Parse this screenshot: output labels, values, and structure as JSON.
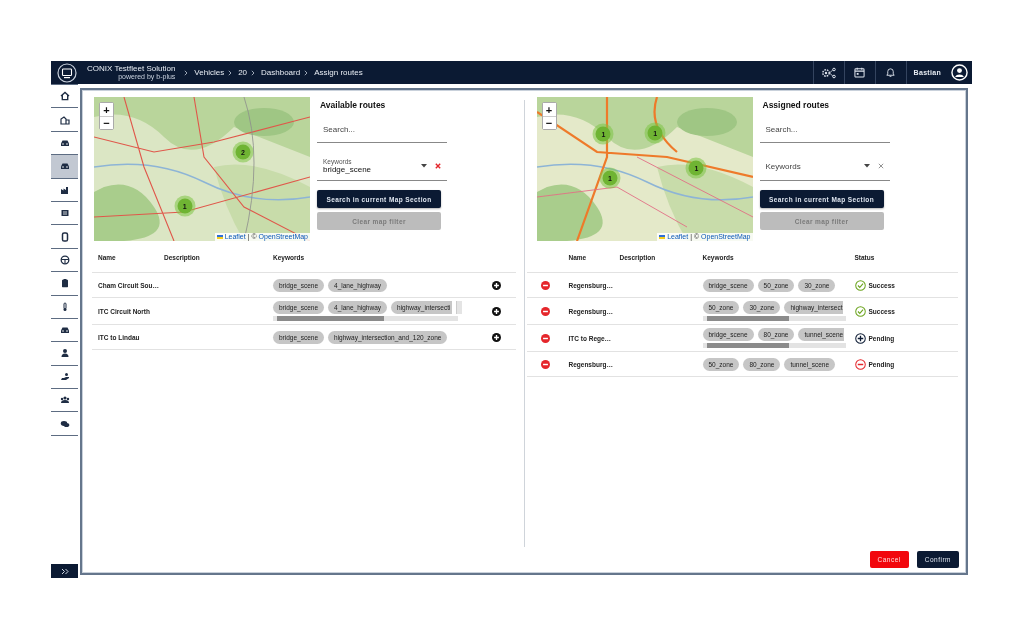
{
  "topbar": {
    "title": "CONIX Testfleet Solution",
    "subtitle": "powered by b-plus",
    "breadcrumbs": [
      "Vehicles",
      "20",
      "Dashboard",
      "Assign routes"
    ],
    "user": "Bastian"
  },
  "sidebar": {
    "items": [
      {
        "selected": false
      },
      {
        "selected": false
      },
      {
        "selected": false
      },
      {
        "selected": true
      },
      {
        "selected": false
      },
      {
        "selected": false
      },
      {
        "selected": false
      },
      {
        "selected": false
      },
      {
        "selected": false
      },
      {
        "selected": false
      },
      {
        "selected": false
      },
      {
        "selected": false
      },
      {
        "selected": false
      },
      {
        "selected": false
      },
      {
        "selected": false
      }
    ]
  },
  "panels": [
    {
      "title": "Available routes",
      "map": {
        "zoom_in": "+",
        "zoom_out": "−",
        "attribution": {
          "leaflet": "Leaflet",
          "separator": "| ©",
          "osm": "OpenStreetMap"
        },
        "markers": [
          {
            "count": "2"
          },
          {
            "count": "1"
          }
        ]
      },
      "search": {
        "placeholder": "Search..."
      },
      "keywords": {
        "label": "Keywords",
        "value": "bridge_scene"
      },
      "buttons": [
        {
          "label": "Search in current Map Section",
          "disabled": false
        },
        {
          "label": "Clear map filter",
          "disabled": true
        }
      ],
      "table": {
        "columns": [
          "Name",
          "Description",
          "Keywords"
        ],
        "rows": [
          {
            "name": "Cham Circuit Sou…",
            "keywords": [
              {
                "text": "bridge_scene",
                "cut": false
              },
              {
                "text": "4_lane_highway",
                "cut": false
              }
            ],
            "scrollbar": false
          },
          {
            "name": "ITC Circuit North",
            "keywords": [
              {
                "text": "bridge_scene",
                "cut": false
              },
              {
                "text": "4_lane_highway",
                "cut": false
              },
              {
                "text": "highway_intersecti",
                "cut": true
              }
            ],
            "scrollbar": true
          },
          {
            "name": "ITC to Lindau",
            "keywords": [
              {
                "text": "bridge_scene",
                "cut": false
              },
              {
                "text": "highway_intersection_and_120_zone",
                "cut": false
              }
            ],
            "scrollbar": false
          }
        ]
      }
    },
    {
      "title": "Assigned routes",
      "map": {
        "zoom_in": "+",
        "zoom_out": "−",
        "attribution": {
          "leaflet": "Leaflet",
          "separator": "| ©",
          "osm": "OpenStreetMap"
        },
        "markers": [
          {
            "count": "1"
          },
          {
            "count": "1"
          },
          {
            "count": "1"
          },
          {
            "count": "1"
          }
        ]
      },
      "search": {
        "placeholder": "Search..."
      },
      "keywords": {
        "placeholder": "Keywords"
      },
      "buttons": [
        {
          "label": "Search in current Map Section",
          "disabled": false
        },
        {
          "label": "Clear map filter",
          "disabled": true
        }
      ],
      "table": {
        "columns": [
          "Name",
          "Description",
          "Keywords",
          "Status"
        ],
        "rows": [
          {
            "name": "Regensburg…",
            "keywords": [
              {
                "text": "bridge_scene",
                "cut": false
              },
              {
                "text": "50_zone",
                "cut": false
              },
              {
                "text": "30_zone",
                "cut": false
              }
            ],
            "scrollbar": false,
            "status": {
              "label": "Success",
              "kind": "success"
            }
          },
          {
            "name": "Regensburg…",
            "keywords": [
              {
                "text": "50_zone",
                "cut": false
              },
              {
                "text": "30_zone",
                "cut": false
              },
              {
                "text": "highway_intersect",
                "cut": true
              }
            ],
            "scrollbar": true,
            "status": {
              "label": "Success",
              "kind": "success"
            }
          },
          {
            "name": "ITC to Rege…",
            "keywords": [
              {
                "text": "bridge_scene",
                "cut": false
              },
              {
                "text": "80_zone",
                "cut": false
              },
              {
                "text": "tunnel_scene",
                "cut": true
              }
            ],
            "scrollbar": true,
            "status": {
              "label": "Pending",
              "kind": "add"
            }
          },
          {
            "name": "Regensburg…",
            "keywords": [
              {
                "text": "50_zone",
                "cut": false
              },
              {
                "text": "80_zone",
                "cut": false
              },
              {
                "text": "tunnel_scene",
                "cut": false
              }
            ],
            "scrollbar": false,
            "status": {
              "label": "Pending",
              "kind": "remove"
            }
          }
        ]
      }
    }
  ],
  "footer": {
    "buttons": [
      {
        "label": "Cancel",
        "kind": "cancel"
      },
      {
        "label": "Confirm",
        "kind": "confirm"
      }
    ]
  }
}
